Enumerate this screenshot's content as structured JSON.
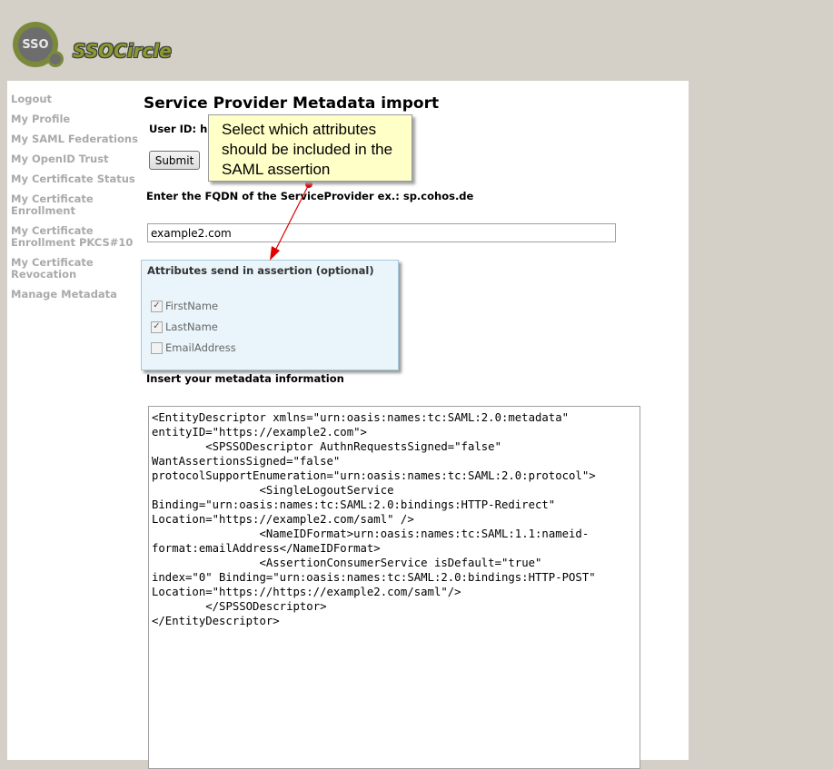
{
  "logo": {
    "circle_text": "SSO",
    "brand": "SSOCircle"
  },
  "sidebar": {
    "items": [
      {
        "label": "Logout"
      },
      {
        "label": "My Profile"
      },
      {
        "label": "My SAML Federations"
      },
      {
        "label": "My OpenID Trust"
      },
      {
        "label": "My Certificate Status"
      },
      {
        "label": "My Certificate Enrollment"
      },
      {
        "label": "My Certificate Enrollment PKCS#10"
      },
      {
        "label": "My Certificate Revocation"
      },
      {
        "label": "Manage Metadata"
      }
    ]
  },
  "main": {
    "title": "Service Provider Metadata import",
    "user_id_label": "User ID: h",
    "submit_label": "Submit",
    "fqdn_label": "Enter the FQDN of the ServiceProvider ex.: sp.cohos.de",
    "fqdn_value": "example2.com",
    "attributes": {
      "title": "Attributes send in assertion (optional)",
      "items": [
        {
          "label": "FirstName",
          "checked": true
        },
        {
          "label": "LastName",
          "checked": true
        },
        {
          "label": "EmailAddress",
          "checked": false
        }
      ]
    },
    "metadata_label": "Insert your metadata information",
    "metadata_value": "<EntityDescriptor xmlns=\"urn:oasis:names:tc:SAML:2.0:metadata\"\nentityID=\"https://example2.com\">\n        <SPSSODescriptor AuthnRequestsSigned=\"false\"\nWantAssertionsSigned=\"false\"\nprotocolSupportEnumeration=\"urn:oasis:names:tc:SAML:2.0:protocol\">\n                <SingleLogoutService\nBinding=\"urn:oasis:names:tc:SAML:2.0:bindings:HTTP-Redirect\"\nLocation=\"https://example2.com/saml\" />\n                <NameIDFormat>urn:oasis:names:tc:SAML:1.1:nameid-\nformat:emailAddress</NameIDFormat>\n                <AssertionConsumerService isDefault=\"true\"\nindex=\"0\" Binding=\"urn:oasis:names:tc:SAML:2.0:bindings:HTTP-POST\"\nLocation=\"https://https://example2.com/saml\"/>\n        </SPSSODescriptor>\n</EntityDescriptor>"
  },
  "callout": {
    "text": "Select which attributes should be included in the SAML assertion"
  },
  "colors": {
    "background": "#d4d0c8",
    "sidebar_link": "#aaaaaa",
    "callout_bg": "#ffffc8",
    "attr_box_bg": "#eaf5fb",
    "arrow": "#e00000"
  }
}
